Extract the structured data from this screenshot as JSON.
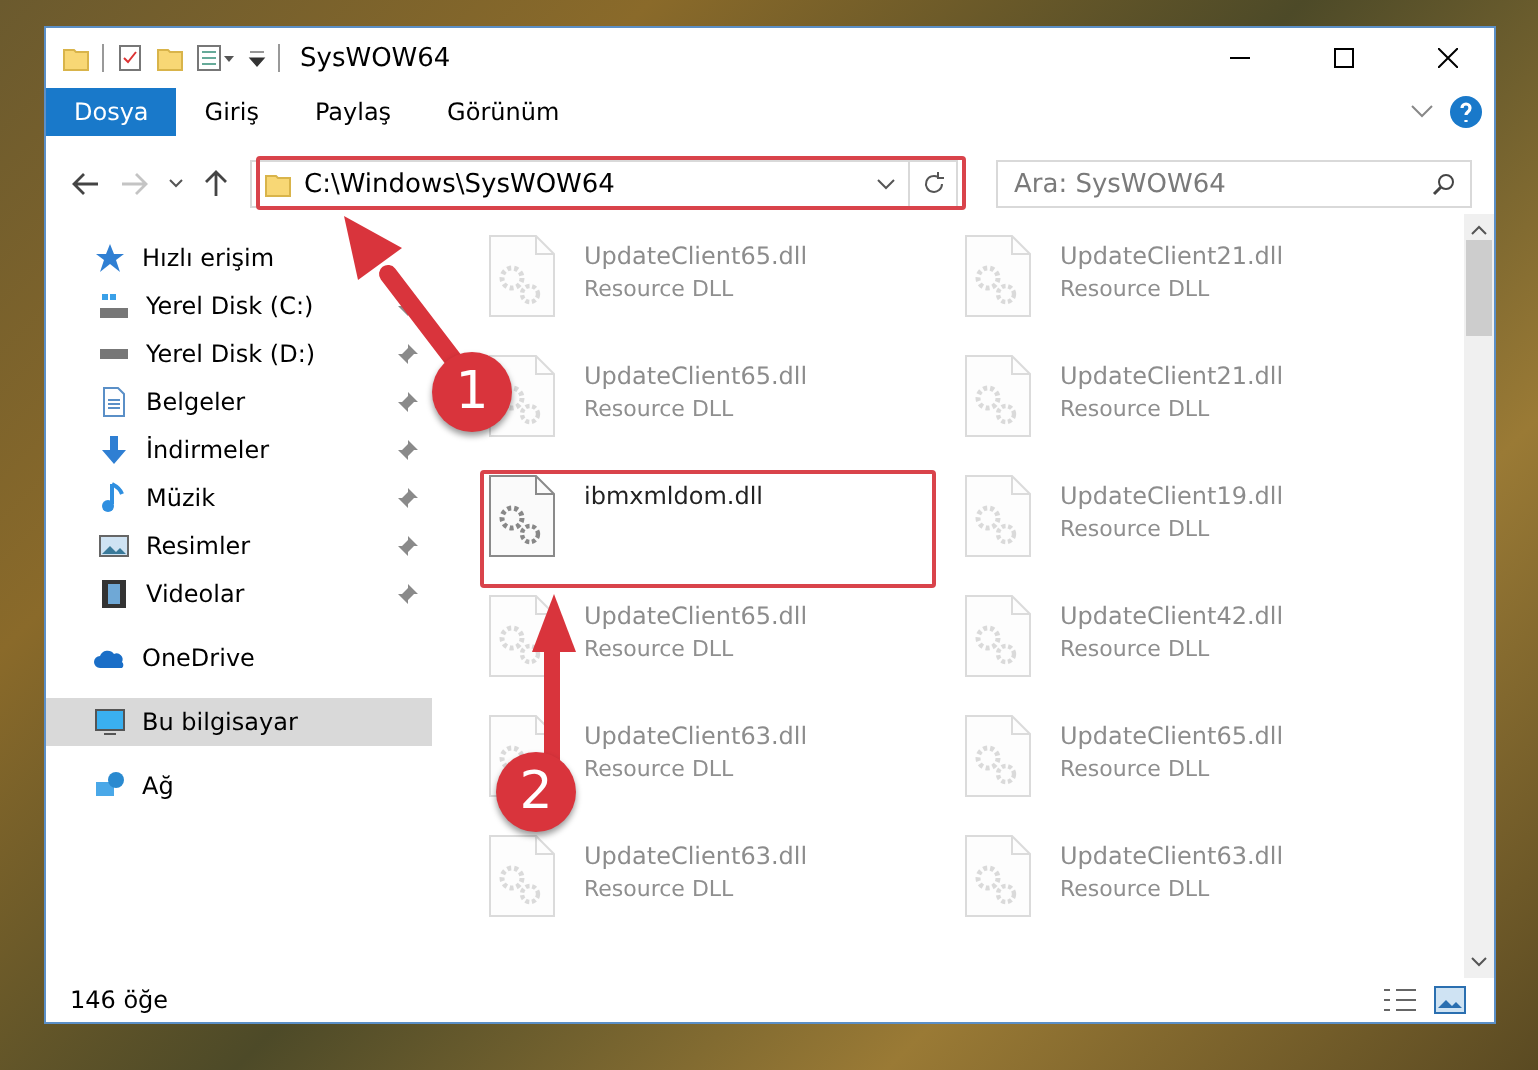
{
  "window": {
    "title": "SysWOW64"
  },
  "ribbon": {
    "tabs": [
      {
        "label": "Dosya",
        "selected": true
      },
      {
        "label": "Giriş",
        "selected": false
      },
      {
        "label": "Paylaş",
        "selected": false
      },
      {
        "label": "Görünüm",
        "selected": false
      }
    ]
  },
  "address": {
    "path": "C:\\Windows\\SysWOW64"
  },
  "search": {
    "placeholder": "Ara: SysWOW64"
  },
  "sidebar": {
    "items": [
      {
        "label": "Hızlı erişim",
        "kind": "star",
        "selected": false,
        "children": [
          {
            "label": "Yerel Disk (C:)",
            "kind": "drive-c",
            "pinned": true,
            "selected": false
          },
          {
            "label": "Yerel Disk (D:)",
            "kind": "drive",
            "pinned": true,
            "selected": false
          },
          {
            "label": "Belgeler",
            "kind": "document",
            "pinned": true,
            "selected": false
          },
          {
            "label": "İndirmeler",
            "kind": "download",
            "pinned": true,
            "selected": false
          },
          {
            "label": "Müzik",
            "kind": "music",
            "pinned": true,
            "selected": false
          },
          {
            "label": "Resimler",
            "kind": "picture",
            "pinned": true,
            "selected": false
          },
          {
            "label": "Videolar",
            "kind": "video",
            "pinned": true,
            "selected": false
          }
        ]
      },
      {
        "label": "OneDrive",
        "kind": "cloud",
        "selected": false
      },
      {
        "label": "Bu bilgisayar",
        "kind": "computer",
        "selected": true
      },
      {
        "label": "Ağ",
        "kind": "network",
        "selected": false
      }
    ]
  },
  "files": [
    {
      "name": "UpdateClient65.dll",
      "type": "Resource DLL",
      "faded": true
    },
    {
      "name": "UpdateClient21.dll",
      "type": "Resource DLL",
      "faded": true
    },
    {
      "name": "UpdateClient65.dll",
      "type": "Resource DLL",
      "faded": true
    },
    {
      "name": "UpdateClient21.dll",
      "type": "Resource DLL",
      "faded": true
    },
    {
      "name": "ibmxmldom.dll",
      "faded": false
    },
    {
      "name": "UpdateClient19.dll",
      "type": "Resource DLL",
      "faded": true
    },
    {
      "name": "UpdateClient65.dll",
      "type": "Resource DLL",
      "faded": true
    },
    {
      "name": "UpdateClient42.dll",
      "type": "Resource DLL",
      "faded": true
    },
    {
      "name": "UpdateClient63.dll",
      "type": "Resource DLL",
      "faded": true
    },
    {
      "name": "UpdateClient65.dll",
      "type": "Resource DLL",
      "faded": true
    },
    {
      "name": "UpdateClient63.dll",
      "type": "Resource DLL",
      "faded": true
    },
    {
      "name": "UpdateClient63.dll",
      "type": "Resource DLL",
      "faded": true
    }
  ],
  "annotations": [
    {
      "number": "1"
    },
    {
      "number": "2"
    }
  ],
  "status_bar": {
    "count": "146 öğe"
  }
}
